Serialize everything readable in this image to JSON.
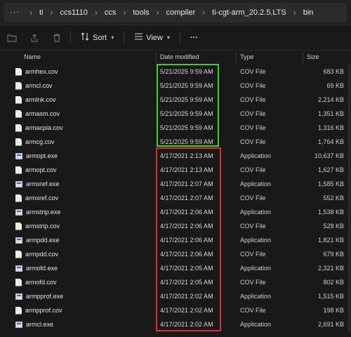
{
  "breadcrumb": {
    "more": "···",
    "items": [
      "ti",
      "ccs1110",
      "ccs",
      "tools",
      "compiler",
      "ti-cgt-arm_20.2.5.LTS",
      "bin"
    ]
  },
  "toolbar": {
    "icons": [
      "new-folder-icon",
      "share-icon",
      "delete-icon"
    ],
    "sort_label": "Sort",
    "view_label": "View",
    "more_label": "···"
  },
  "columns": {
    "name": "Name",
    "date": "Date modified",
    "type": "Type",
    "size": "Size"
  },
  "files": [
    {
      "name": "armhex.cov",
      "date": "5/21/2025 9:59 AM",
      "type": "COV File",
      "size": "683 KB",
      "icon": "doc"
    },
    {
      "name": "armcl.cov",
      "date": "5/21/2025 9:59 AM",
      "type": "COV File",
      "size": "69 KB",
      "icon": "doc"
    },
    {
      "name": "armlnk.cov",
      "date": "5/21/2025 9:59 AM",
      "type": "COV File",
      "size": "2,214 KB",
      "icon": "doc"
    },
    {
      "name": "armasm.cov",
      "date": "5/21/2025 9:59 AM",
      "type": "COV File",
      "size": "1,351 KB",
      "icon": "doc"
    },
    {
      "name": "armacpia.cov",
      "date": "5/21/2025 9:59 AM",
      "type": "COV File",
      "size": "1,316 KB",
      "icon": "doc"
    },
    {
      "name": "armcg.cov",
      "date": "5/21/2025 9:59 AM",
      "type": "COV File",
      "size": "1,764 KB",
      "icon": "doc"
    },
    {
      "name": "armopt.exe",
      "date": "4/17/2021 2:13 AM",
      "type": "Application",
      "size": "10,637 KB",
      "icon": "exe"
    },
    {
      "name": "armopt.cov",
      "date": "4/17/2021 2:13 AM",
      "type": "COV File",
      "size": "1,627 KB",
      "icon": "doc"
    },
    {
      "name": "armxref.exe",
      "date": "4/17/2021 2:07 AM",
      "type": "Application",
      "size": "1,585 KB",
      "icon": "exe"
    },
    {
      "name": "armxref.cov",
      "date": "4/17/2021 2:07 AM",
      "type": "COV File",
      "size": "552 KB",
      "icon": "doc"
    },
    {
      "name": "armstrip.exe",
      "date": "4/17/2021 2:06 AM",
      "type": "Application",
      "size": "1,538 KB",
      "icon": "exe"
    },
    {
      "name": "armstrip.cov",
      "date": "4/17/2021 2:06 AM",
      "type": "COV File",
      "size": "528 KB",
      "icon": "doc"
    },
    {
      "name": "armpdd.exe",
      "date": "4/17/2021 2:06 AM",
      "type": "Application",
      "size": "1,821 KB",
      "icon": "exe"
    },
    {
      "name": "armpdd.cov",
      "date": "4/17/2021 2:06 AM",
      "type": "COV File",
      "size": "679 KB",
      "icon": "doc"
    },
    {
      "name": "armofd.exe",
      "date": "4/17/2021 2:05 AM",
      "type": "Application",
      "size": "2,321 KB",
      "icon": "exe"
    },
    {
      "name": "armofd.cov",
      "date": "4/17/2021 2:05 AM",
      "type": "COV File",
      "size": "802 KB",
      "icon": "doc"
    },
    {
      "name": "armpprof.exe",
      "date": "4/17/2021 2:02 AM",
      "type": "Application",
      "size": "1,515 KB",
      "icon": "exe"
    },
    {
      "name": "armpprof.cov",
      "date": "4/17/2021 2:02 AM",
      "type": "COV File",
      "size": "198 KB",
      "icon": "doc"
    },
    {
      "name": "armcl.exe",
      "date": "4/17/2021 2:02 AM",
      "type": "Application",
      "size": "2,691 KB",
      "icon": "exe"
    }
  ],
  "highlights": {
    "green": "#3ccf2f",
    "red": "#e02b2b"
  }
}
